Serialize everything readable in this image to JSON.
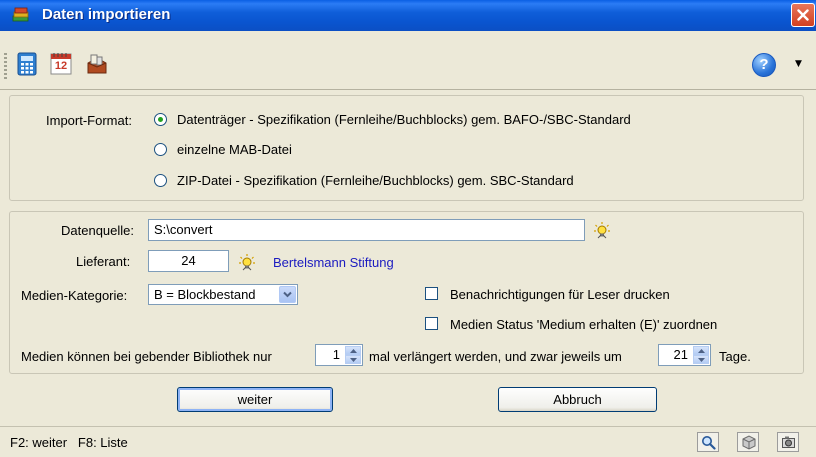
{
  "window": {
    "title": "Daten importieren"
  },
  "toolbar": {
    "icons": [
      "calculator-icon",
      "calendar-icon",
      "mailbox-icon",
      "help-icon"
    ],
    "calendar_day": "12"
  },
  "import_format": {
    "label": "Import-Format:",
    "options": [
      {
        "label": "Datenträger - Spezifikation (Fernleihe/Buchblocks) gem. BAFO-/SBC-Standard",
        "selected": true
      },
      {
        "label": "einzelne MAB-Datei",
        "selected": false
      },
      {
        "label": "ZIP-Datei - Spezifikation (Fernleihe/Buchblocks) gem. SBC-Standard",
        "selected": false
      }
    ]
  },
  "form": {
    "datenquelle_label": "Datenquelle:",
    "datenquelle_value": "S:\\convert",
    "lieferant_label": "Lieferant:",
    "lieferant_value": "24",
    "lieferant_name": "Bertelsmann Stiftung",
    "medien_kategorie_label": "Medien-Kategorie:",
    "medien_kategorie_value": "B = Blockbestand",
    "checkbox_benachrichtigungen": "Benachrichtigungen für Leser drucken",
    "checkbox_medien_status": "Medien Status 'Medium erhalten (E)' zuordnen",
    "renew_text_1": "Medien können bei gebender Bibliothek nur",
    "renew_count": "1",
    "renew_text_2": "mal verlängert werden, und zwar jeweils um",
    "renew_days": "21",
    "renew_text_3": "Tage."
  },
  "buttons": {
    "weiter": "weiter",
    "abbruch": "Abbruch"
  },
  "statusbar": {
    "text": "F2: weiter   F8: Liste"
  },
  "colors": {
    "titlebar": "#0a55d0",
    "window_bg": "#ece9d8",
    "link": "#1b1bc0",
    "radio_dot": "#21a121"
  }
}
